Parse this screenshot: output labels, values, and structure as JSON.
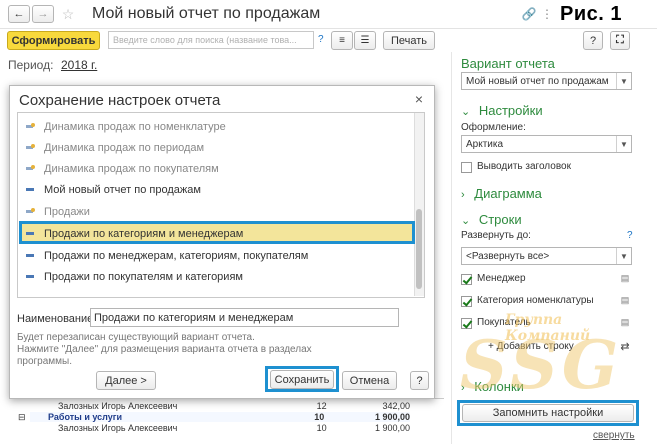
{
  "window": {
    "title": "Мой новый отчет по продажам",
    "figure_label": "Рис. 1"
  },
  "toolbar": {
    "generate_label": "Сформировать",
    "search_placeholder": "Введите слово для поиска (название това...",
    "help": "?",
    "print_label": "Печать",
    "help2": "?"
  },
  "period": {
    "label": "Период:",
    "value": "2018 г."
  },
  "dialog": {
    "title": "Сохранение настроек отчета",
    "items": [
      {
        "label": "Динамика продаж по номенклатуре",
        "style": "gray"
      },
      {
        "label": "Динамика продаж по периодам",
        "style": "gray"
      },
      {
        "label": "Динамика продаж по покупателям",
        "style": "gray"
      },
      {
        "label": "Мой новый отчет по продажам",
        "style": "blue"
      },
      {
        "label": "Продажи",
        "style": "gray"
      },
      {
        "label": "Продажи по категориям и менеджерам",
        "style": "selected"
      },
      {
        "label": "Продажи по менеджерам, категориям, покупателям",
        "style": "blue"
      },
      {
        "label": "Продажи по покупателям и категориям",
        "style": "blue"
      }
    ],
    "name_label": "Наименование:",
    "name_value": "Продажи по категориям и менеджерам",
    "info_line1": "Будет перезаписан существующий вариант отчета.",
    "info_line2": "Нажмите \"Далее\" для размещения варианта отчета в разделах",
    "info_line3": "программы.",
    "next_label": "Далее >",
    "save_label": "Сохранить",
    "cancel_label": "Отмена",
    "help": "?"
  },
  "table": {
    "rows": [
      {
        "name": "Залозных Игорь Алексеевич",
        "qty": "12",
        "sum": "342,00",
        "bold": false
      },
      {
        "name": "Работы и услуги",
        "qty": "10",
        "sum": "1 900,00",
        "bold": true
      },
      {
        "name": "Залозных Игорь Алексеевич",
        "qty": "10",
        "sum": "1 900,00",
        "bold": false
      }
    ]
  },
  "panel": {
    "variant_title": "Вариант отчета",
    "variant_value": "Мой новый отчет по продажам",
    "settings_title": "Настройки",
    "design_label": "Оформление:",
    "design_value": "Арктика",
    "show_header_label": "Выводить заголовок",
    "diagram_title": "Диаграмма",
    "rows_title": "Строки",
    "expand_label": "Развернуть до:",
    "expand_help": "?",
    "expand_value": "<Развернуть все>",
    "fields": [
      {
        "label": "Менеджер",
        "checked": true
      },
      {
        "label": "Категория номенклатуры",
        "checked": true
      },
      {
        "label": "Покупатель",
        "checked": true
      }
    ],
    "add_row_label": "+ Добавить строку",
    "columns_title": "Колонки",
    "remember_label": "Запомнить настройки",
    "collapse_label": "свернуть"
  },
  "watermark": {
    "line1": "Группа Компаний",
    "line2": "SSG"
  },
  "colors": {
    "highlight_border": "#1e90d0",
    "selected_bg": "#f3e59b",
    "accent_green": "#2e8b3e",
    "generate_bg": "#f8d93c"
  }
}
